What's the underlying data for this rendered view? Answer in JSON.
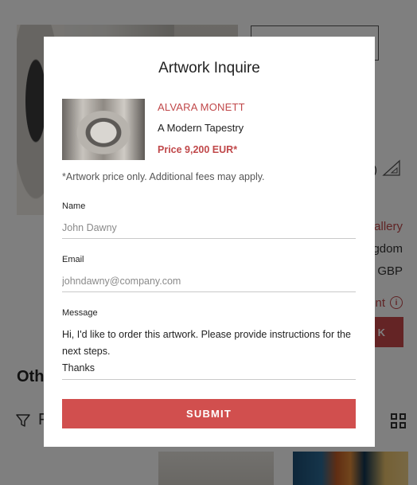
{
  "background": {
    "heading": "Oth",
    "filter_label": "F",
    "lines": [
      "allery",
      "gdom",
      "GBP"
    ],
    "paren": ")",
    "red_link": "nt",
    "red_button": "K",
    "colors": {
      "accent": "#c9494a",
      "overlay": "rgba(0,0,0,0.5)"
    }
  },
  "modal": {
    "title": "Artwork Inquire",
    "artwork": {
      "artist": "ALVARA MONETT",
      "title": "A Modern Tapestry",
      "price": "Price 9,200 EUR*"
    },
    "note": "*Artwork price only. Additional fees may apply.",
    "fields": {
      "name_label": "Name",
      "name_placeholder": "John Dawny",
      "email_label": "Email",
      "email_placeholder": "johndawny@company.com",
      "message_label": "Message",
      "message_value": "Hi, I'd like to order this artwork. Please provide instructions for the next steps.\nThanks"
    },
    "submit_label": "SUBMIT"
  }
}
